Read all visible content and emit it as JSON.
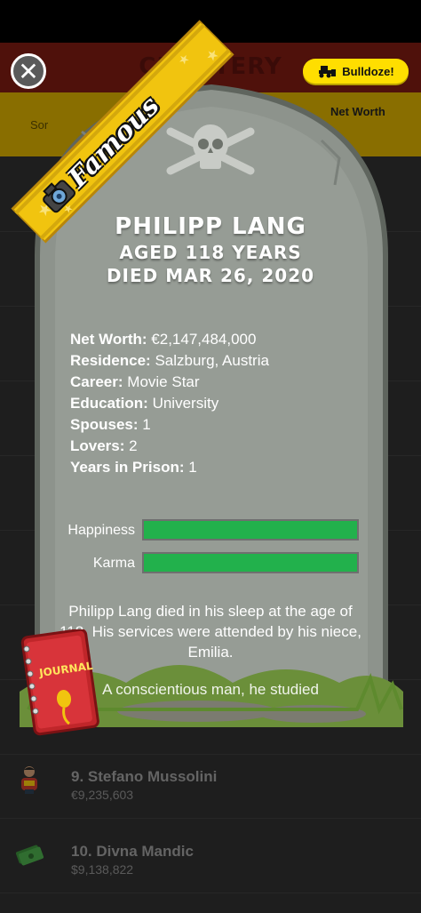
{
  "header": {
    "title": "CEMETERY",
    "bulldoze_label": "Bulldoze!"
  },
  "sortbar": {
    "sort_label": "Sor",
    "networth_label": "Net Worth"
  },
  "background_list": [
    {
      "rank_name": "9. Stefano Mussolini",
      "net_worth": "€9,235,603",
      "icon": "hero-avatar-icon"
    },
    {
      "rank_name": "10. Divna Mandic",
      "net_worth": "$9,138,822",
      "icon": "money-stack-icon"
    }
  ],
  "ribbon": {
    "label": "Famous",
    "icon": "camera-icon"
  },
  "tomb": {
    "name": "PHILIPP LANG",
    "aged": "AGED 118 YEARS",
    "died": "DIED MAR 26, 2020",
    "details": [
      {
        "key": "Net Worth:",
        "value": "€2,147,484,000"
      },
      {
        "key": "Residence:",
        "value": "Salzburg, Austria"
      },
      {
        "key": "Career:",
        "value": "Movie Star"
      },
      {
        "key": "Education:",
        "value": "University"
      },
      {
        "key": "Spouses:",
        "value": "1"
      },
      {
        "key": "Lovers:",
        "value": "2"
      },
      {
        "key": "Years in Prison:",
        "value": "1"
      }
    ],
    "meters": [
      {
        "label": "Happiness",
        "level": 1.0
      },
      {
        "label": "Karma",
        "level": 1.0
      }
    ],
    "obituary": "Philipp Lang died in his sleep at the age of 118. His services were attended by his niece, Emilia.",
    "obituary_more": "A conscientious man, he studied",
    "journal_label": "JOURNAL"
  },
  "colors": {
    "meter_fill": "#22b14c",
    "bulldoze_bg": "#ffde00",
    "header_bg": "#7a1b12",
    "sortbar_bg": "#d3a900",
    "ribbon": "#f1c40f"
  }
}
